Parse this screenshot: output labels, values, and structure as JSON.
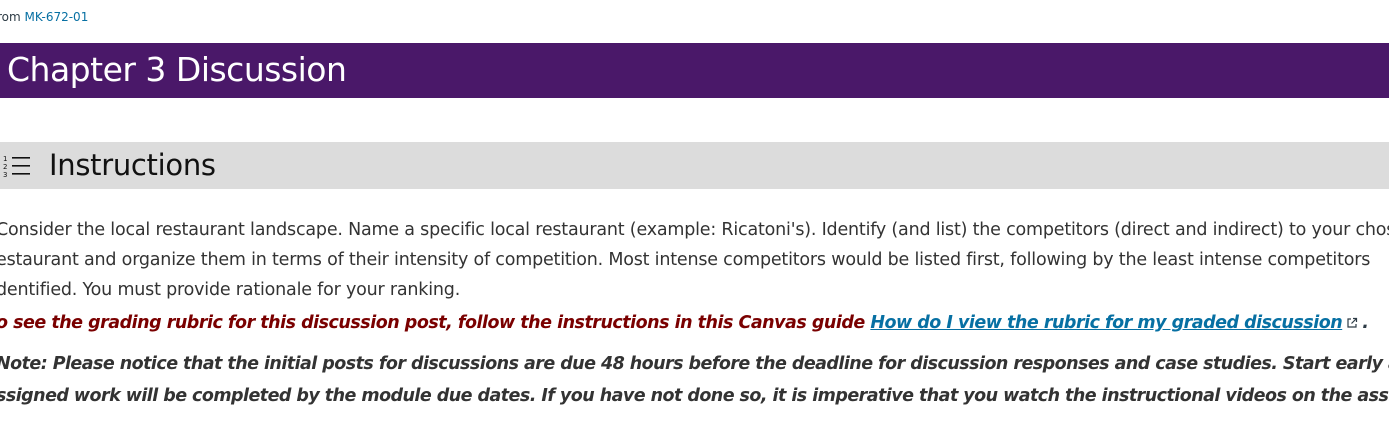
{
  "breadcrumb": {
    "prefix": "rom",
    "link": "MK-672-01"
  },
  "page": {
    "title": "Chapter 3 Discussion"
  },
  "section": {
    "icon": "numbered-list-icon",
    "heading": "Instructions"
  },
  "instructions": {
    "lines": [
      "Consider the local restaurant landscape.  Name a specific local restaurant (example: Ricatoni's).  Identify (and list) the competitors (direct and indirect) to your chos",
      "estaurant and organize them in terms of their intensity of competition.  Most intense competitors would be listed first, following by the least intense competitors",
      "dentified.  You must provide rationale for your ranking."
    ]
  },
  "rubric": {
    "text": "o see the grading rubric for this discussion post, follow the instructions in this Canvas guide ",
    "link_text": "How do I view the rubric for my graded discussion",
    "link_icon": "external-link-icon",
    "trailing": "."
  },
  "note": {
    "lines": [
      "Note: Please notice that the initial posts for discussions are due 48 hours before the deadline for discussion responses and case studies. Start early and work ahead so that all",
      "ssigned work will be completed by the module due dates. If you have not done so, it is imperative that you watch the instructional videos on the assignment rubrics in Canvas."
    ]
  },
  "colors": {
    "title_bar": "#4a1869",
    "section_bar": "#dcdcdc",
    "rubric_text": "#7a0000",
    "link": "#0770a3"
  }
}
